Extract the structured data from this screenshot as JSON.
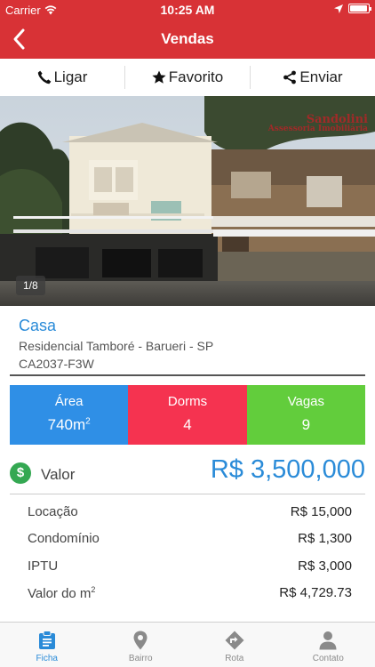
{
  "status_bar": {
    "carrier": "Carrier",
    "time": "10:25 AM",
    "battery_level": 0.95
  },
  "nav": {
    "title": "Vendas"
  },
  "actions": [
    {
      "label": "Ligar",
      "icon": "phone-icon"
    },
    {
      "label": "Favorito",
      "icon": "star-icon"
    },
    {
      "label": "Enviar",
      "icon": "share-icon"
    }
  ],
  "photo": {
    "counter": "1/8",
    "watermark_line1": "Sandolini",
    "watermark_line2": "Assessoria Imobiliária"
  },
  "property": {
    "type": "Casa",
    "location": "Residencial Tamboré - Barueri - SP",
    "code": "CA2037-F3W"
  },
  "stats": {
    "area_label": "Área",
    "area_value": "740m",
    "area_unit_sup": "2",
    "dorms_label": "Dorms",
    "dorms_value": "4",
    "vagas_label": "Vagas",
    "vagas_value": "9"
  },
  "colors": {
    "brand_red": "#d83236",
    "accent_blue": "#2a8bd8",
    "area_blue": "#2f8fe6",
    "dorms_red": "#f53350",
    "vagas_green": "#62cd3c",
    "dollar_green": "#34a852"
  },
  "valor": {
    "label": "Valor",
    "value": "R$ 3,500,000"
  },
  "fees": [
    {
      "label": "Locação",
      "sup": "",
      "value": "R$ 15,000"
    },
    {
      "label": "Condomínio",
      "sup": "",
      "value": "R$ 1,300"
    },
    {
      "label": "IPTU",
      "sup": "",
      "value": "R$ 3,000"
    },
    {
      "label": "Valor do m",
      "sup": "2",
      "value": "R$ 4,729.73"
    }
  ],
  "tabs": [
    {
      "label": "Ficha",
      "icon": "clipboard-icon",
      "active": true
    },
    {
      "label": "Bairro",
      "icon": "map-pin-icon",
      "active": false
    },
    {
      "label": "Rota",
      "icon": "route-icon",
      "active": false
    },
    {
      "label": "Contato",
      "icon": "person-icon",
      "active": false
    }
  ]
}
